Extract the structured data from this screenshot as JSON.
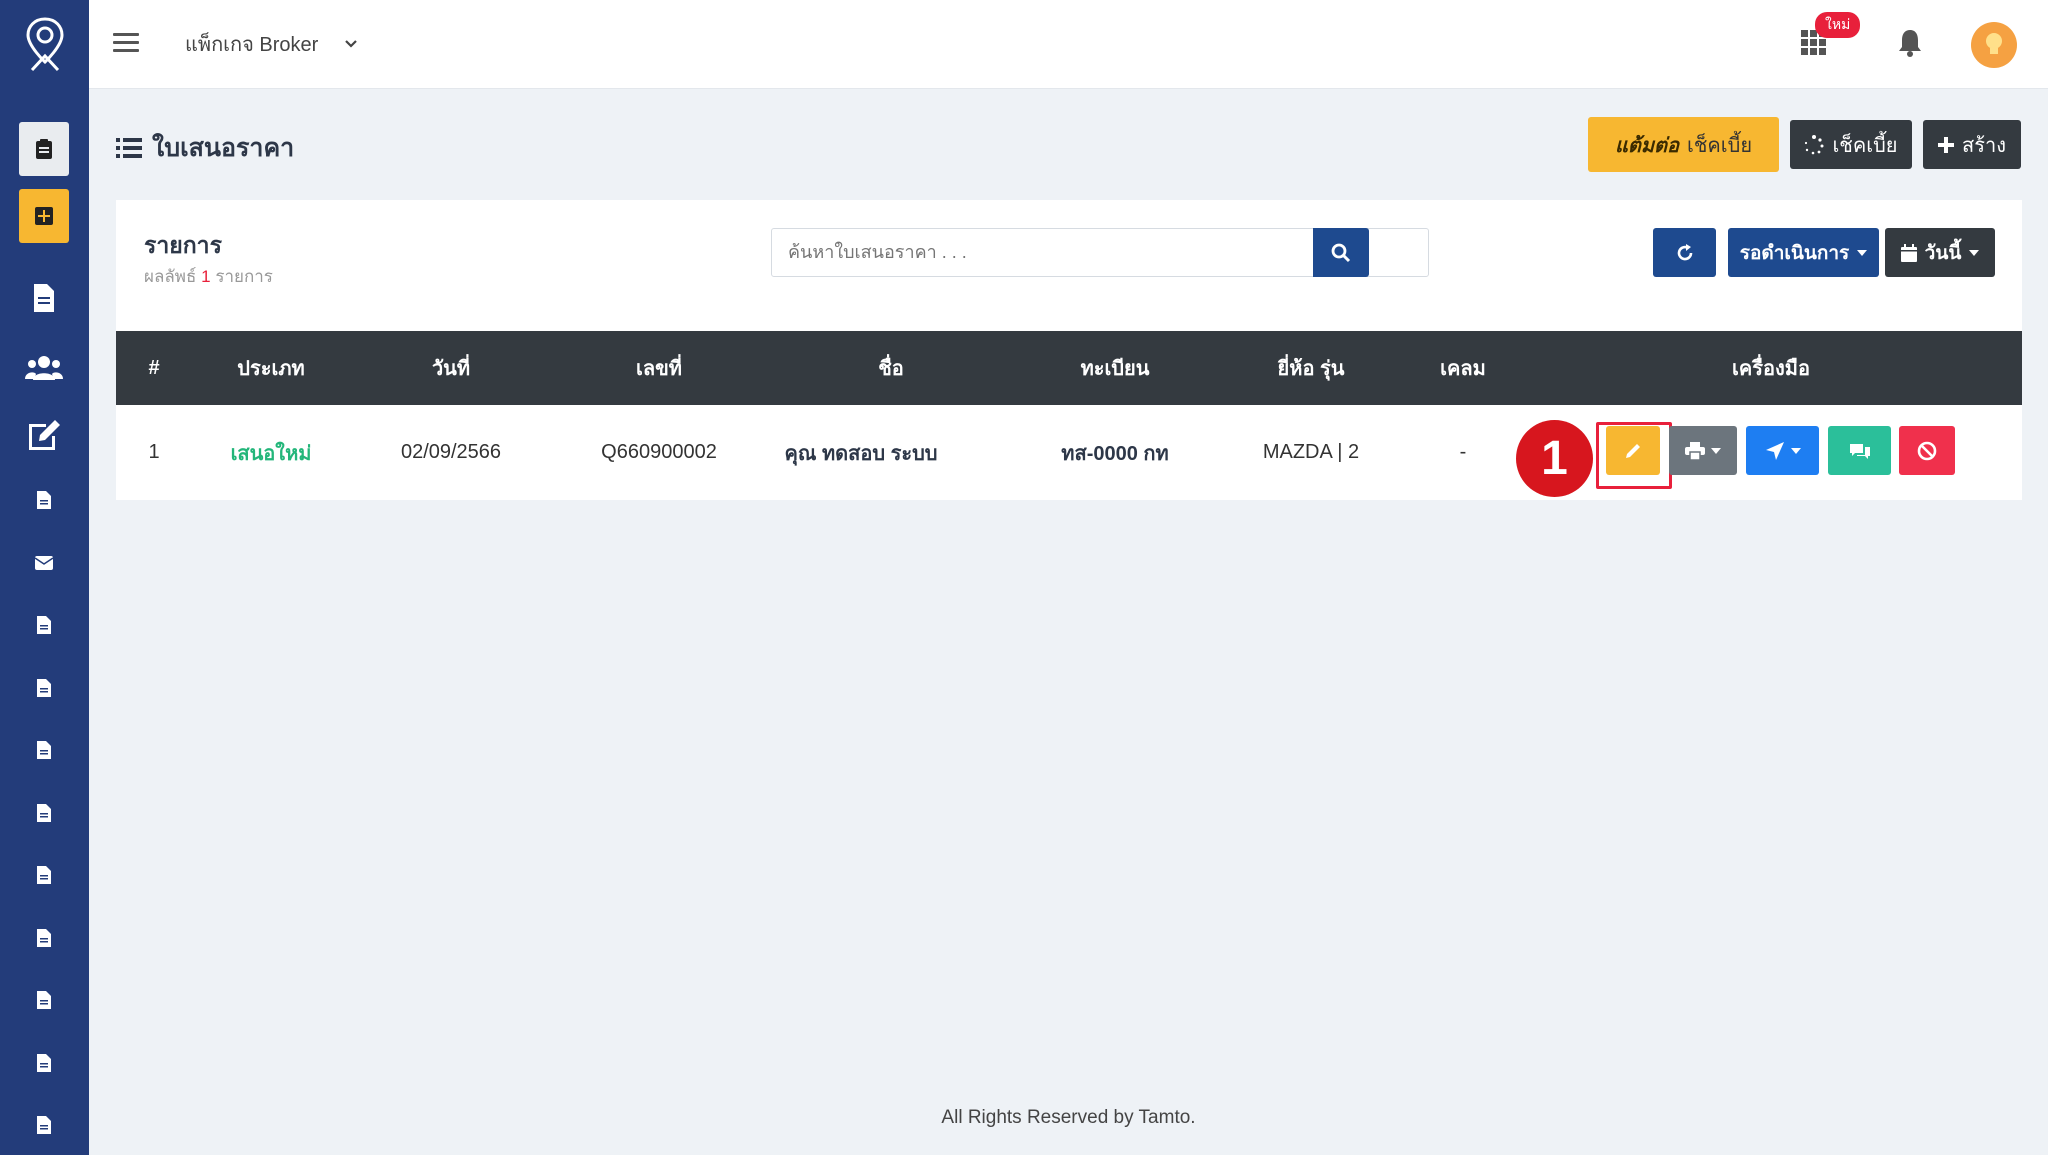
{
  "header": {
    "package_label": "แพ็กเกจ Broker",
    "new_badge": "ใหม่"
  },
  "page": {
    "title": "ใบเสนอราคา",
    "tamto_brand": "แต้มต่อ",
    "tamto_check_label": "เช็คเบี้ย",
    "check_label": "เช็คเบี้ย",
    "create_label": "สร้าง"
  },
  "card": {
    "title": "รายการ",
    "result_prefix": "ผลลัพธ์",
    "result_count": "1",
    "result_suffix": "รายการ",
    "search_placeholder": "ค้นหาใบเสนอราคา . . .",
    "status_filter": "รอดำเนินการ",
    "date_filter": "วันนี้"
  },
  "table": {
    "columns": [
      "#",
      "ประเภท",
      "วันที่",
      "เลขที่",
      "ชื่อ",
      "ทะเบียน",
      "ยี่ห้อ รุ่น",
      "เคลม",
      "เครื่องมือ"
    ],
    "rows": [
      {
        "index": "1",
        "type": "เสนอใหม่",
        "date": "02/09/2566",
        "number": "Q660900002",
        "name": "คุณ ทดสอบ ระบบ",
        "plate": "ทส-0000 กท",
        "brand_model": "MAZDA | 2",
        "claim": "-"
      }
    ]
  },
  "annotation": {
    "step": "1"
  },
  "footer": {
    "text": "All Rights Reserved by Tamto."
  },
  "colors": {
    "sidebar": "#233c7a",
    "accent_amber": "#f7b731",
    "primary_blue": "#1e4a8f",
    "dark": "#343a40",
    "success_text": "#23b67a",
    "danger": "#f0304c",
    "highlight": "#e8203b"
  }
}
